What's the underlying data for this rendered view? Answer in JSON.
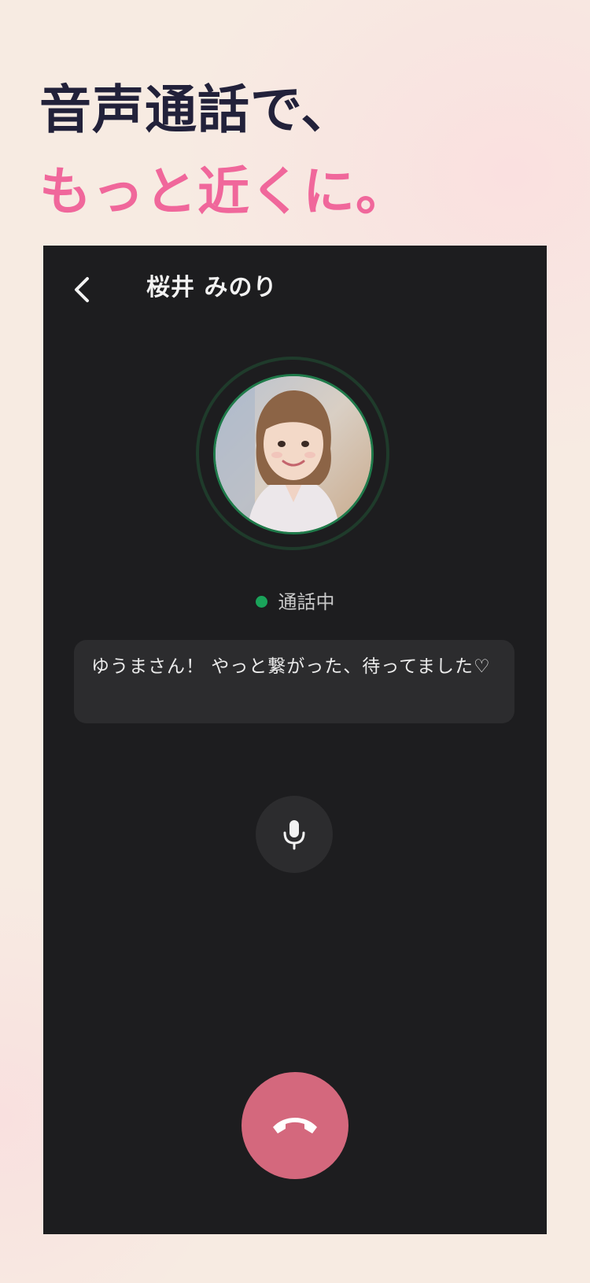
{
  "headline": {
    "line1": "音声通話で、",
    "line2": "もっと近くに。"
  },
  "call": {
    "contact_name": "桜井 みのり",
    "status": "通話中",
    "message": "ゆうまさん！ やっと繋がった、待ってました♡"
  },
  "colors": {
    "headline_dark": "#22213a",
    "headline_pink": "#f0679b",
    "screen_bg": "#1d1d1f",
    "status_green": "#1aa35a",
    "hangup": "#d4687d"
  },
  "icons": {
    "back": "chevron-left-icon",
    "mic": "microphone-icon",
    "hangup": "phone-hangup-icon"
  }
}
